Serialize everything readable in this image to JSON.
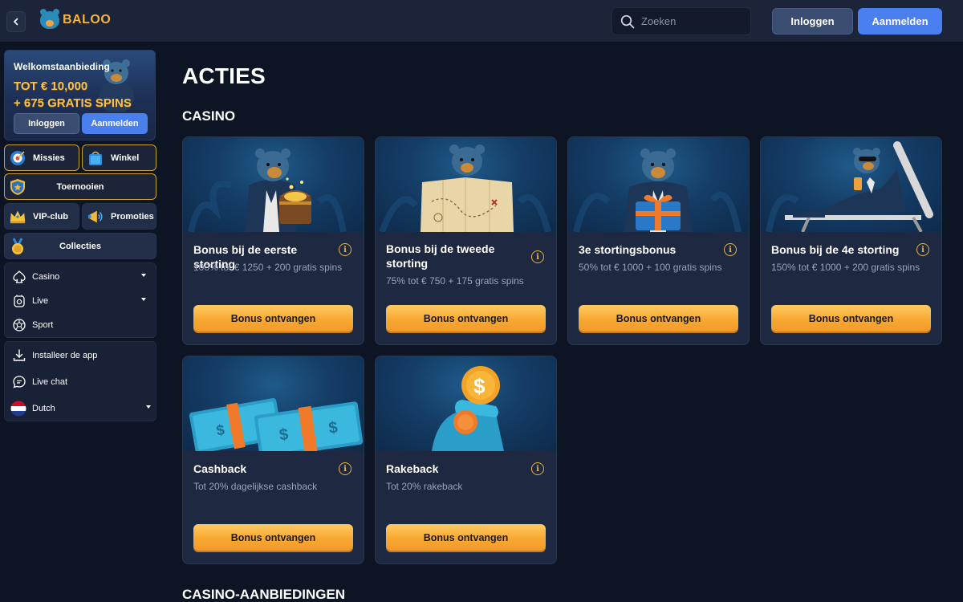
{
  "header": {
    "brand": "BALOO",
    "search_placeholder": "Zoeken",
    "login": "Inloggen",
    "signup": "Aanmelden"
  },
  "sidebar": {
    "promo": {
      "title": "Welkomstaanbieding",
      "line1": "TOT € 10,000",
      "line2": "+ 675 GRATIS SPINS",
      "login": "Inloggen",
      "signup": "Aanmelden"
    },
    "tiles": {
      "missies": "Missies",
      "winkel": "Winkel",
      "toernooien": "Toernooien",
      "vip": "VIP-club",
      "promoties": "Promoties",
      "collecties": "Collecties"
    },
    "nav": {
      "casino": "Casino",
      "live": "Live",
      "sport": "Sport"
    },
    "extra": {
      "app": "Installeer de app",
      "chat": "Live chat",
      "language": "Dutch"
    }
  },
  "main": {
    "title": "ACTIES",
    "section_casino": "CASINO",
    "section_offers": "CASINO-AANBIEDINGEN",
    "button_label": "Bonus ontvangen",
    "cards": [
      {
        "title": "Bonus bij de eerste storting",
        "sub": "100% tot € 1250 + 200 gratis spins"
      },
      {
        "title": "Bonus bij de tweede storting",
        "sub": "75% tot € 750 + 175 gratis spins"
      },
      {
        "title": "3e stortingsbonus",
        "sub": "50% tot € 1000 + 100 gratis spins"
      },
      {
        "title": "Bonus bij de 4e storting",
        "sub": "150% tot € 1000 + 200 gratis spins"
      },
      {
        "title": "Cashback",
        "sub": "Tot 20% dagelijkse cashback"
      },
      {
        "title": "Rakeback",
        "sub": "Tot 20% rakeback"
      }
    ]
  },
  "colors": {
    "background": "#0d1525",
    "header": "#1b2438",
    "accent_blue": "#4a7ff0",
    "accent_gold": "#f8a832",
    "card": "#1e2840"
  }
}
